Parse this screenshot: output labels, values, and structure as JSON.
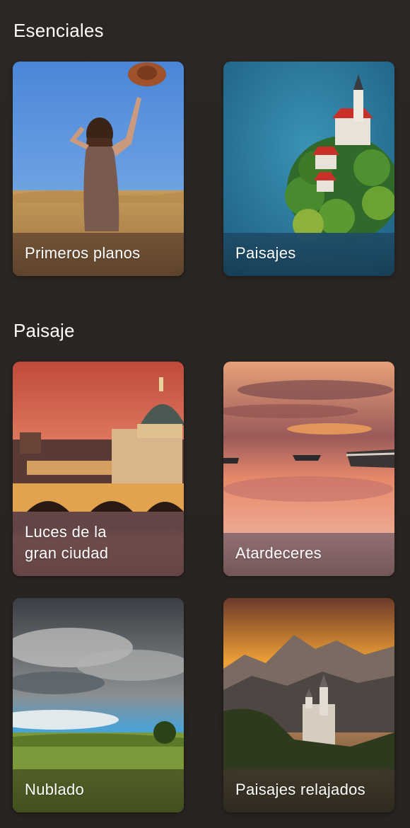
{
  "sections": [
    {
      "title": "Esenciales",
      "cards": [
        {
          "label": "Primeros planos",
          "image": "woman-hat-wheat-field"
        },
        {
          "label": "Paisajes",
          "image": "lake-island-church"
        }
      ]
    },
    {
      "title": "Paisaje",
      "cards": [
        {
          "label": "Luces de la\ngran ciudad",
          "image": "city-dome-bridge-night"
        },
        {
          "label": "Atardeceres",
          "image": "sunset-boats-water"
        },
        {
          "label": "Nublado",
          "image": "storm-clouds-meadow"
        },
        {
          "label": "Paisajes relajados",
          "image": "mountains-castle-sunset"
        }
      ]
    }
  ],
  "colors": {
    "background": "#2a2624",
    "text": "#ffffff"
  }
}
